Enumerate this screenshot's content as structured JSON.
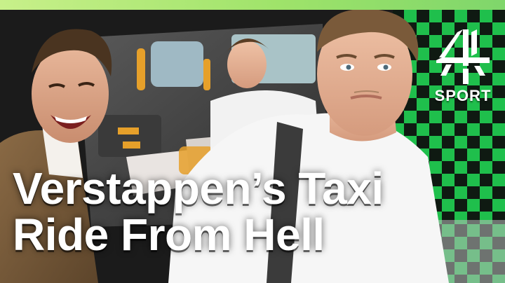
{
  "thumbnail": {
    "title_lines": [
      "Verstappen’s Taxi",
      "Ride From Hell"
    ],
    "logo": {
      "icon": "channel-4-logo-icon",
      "label": "SPORT"
    },
    "colors": {
      "accent_green": "#9fe36a",
      "checker_green": "#1fbf4c",
      "title_text": "#ffffff"
    }
  }
}
